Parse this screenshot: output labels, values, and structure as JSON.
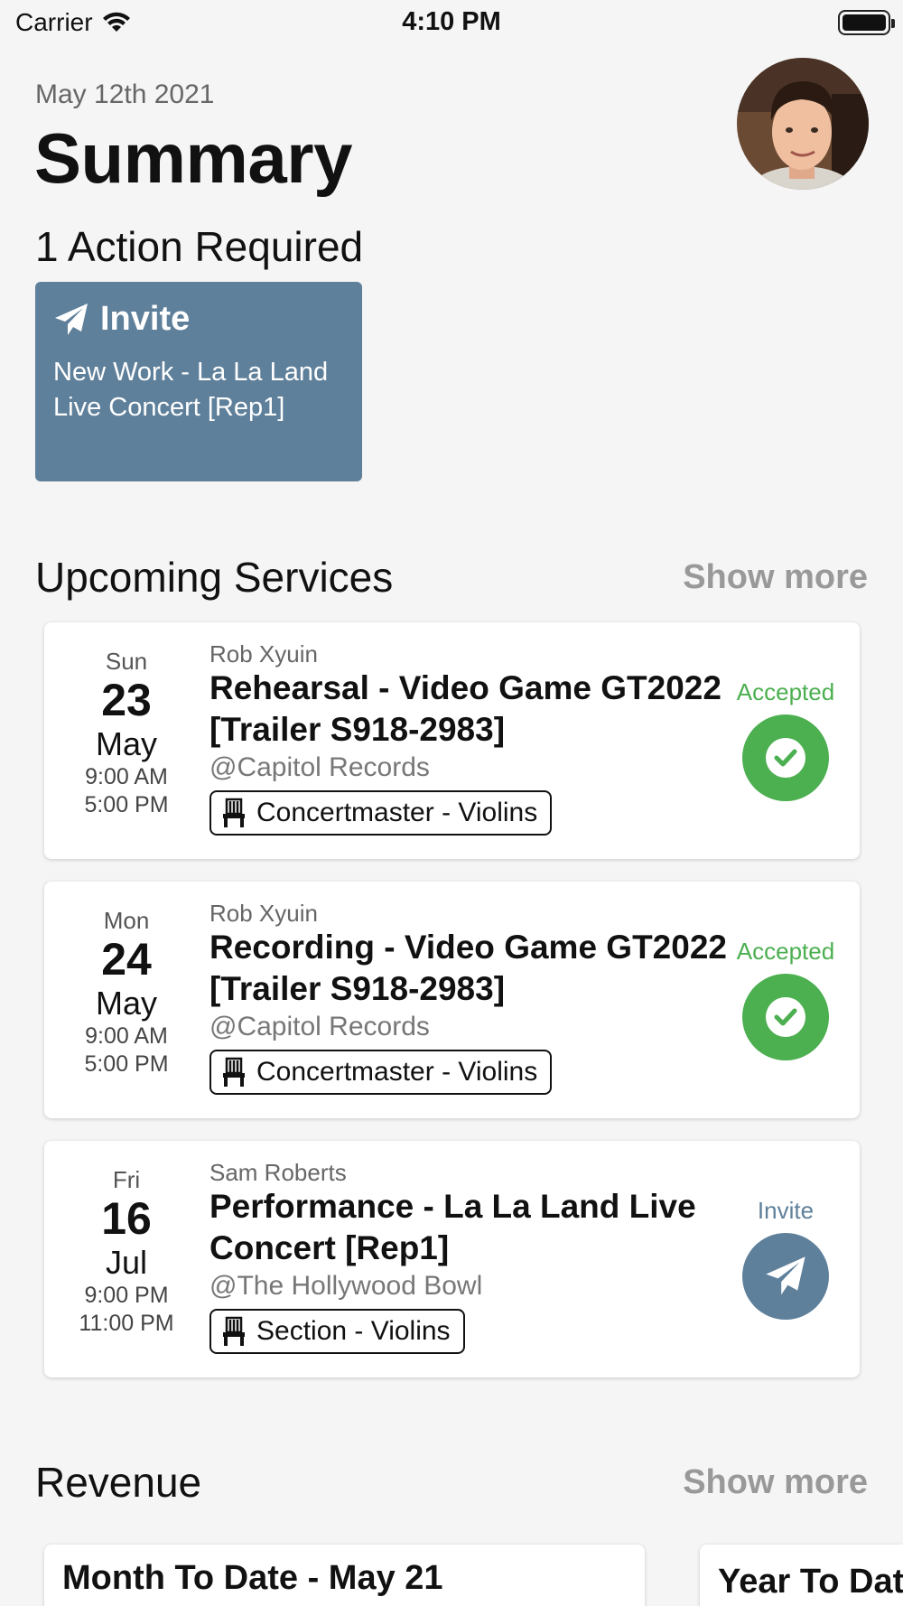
{
  "status_bar": {
    "carrier": "Carrier",
    "time": "4:10 PM"
  },
  "header": {
    "date": "May 12th 2021",
    "title": "Summary"
  },
  "actions": {
    "heading": "1 Action Required",
    "card": {
      "type_label": "Invite",
      "icon": "paper-plane-icon",
      "text": "New Work - La La Land Live Concert [Rep1]",
      "color": "#5f809b"
    }
  },
  "upcoming": {
    "heading": "Upcoming Services",
    "show_more": "Show more",
    "items": [
      {
        "dow": "Sun",
        "day": "23",
        "month": "May",
        "start": "9:00 AM",
        "end": "5:00 PM",
        "contact": "Rob Xyuin",
        "title": "Rehearsal - Video Game GT2022 [Trailer S918-2983]",
        "venue": "@Capitol Records",
        "role": "Concertmaster - Violins",
        "status": "Accepted",
        "status_color": "#4caf50",
        "status_icon": "check-icon"
      },
      {
        "dow": "Mon",
        "day": "24",
        "month": "May",
        "start": "9:00 AM",
        "end": "5:00 PM",
        "contact": "Rob Xyuin",
        "title": "Recording - Video Game GT2022 [Trailer S918-2983]",
        "venue": "@Capitol Records",
        "role": "Concertmaster - Violins",
        "status": "Accepted",
        "status_color": "#4caf50",
        "status_icon": "check-icon"
      },
      {
        "dow": "Fri",
        "day": "16",
        "month": "Jul",
        "start": "9:00 PM",
        "end": "11:00 PM",
        "contact": "Sam Roberts",
        "title": "Performance - La La Land Live Concert [Rep1]",
        "venue": "@The Hollywood Bowl",
        "role": "Section - Violins",
        "status": "Invite",
        "status_color": "#5f809b",
        "status_icon": "paper-plane-icon"
      }
    ]
  },
  "revenue": {
    "heading": "Revenue",
    "show_more": "Show more",
    "cards": [
      "Month To Date - May 21",
      "Year To Date"
    ]
  }
}
